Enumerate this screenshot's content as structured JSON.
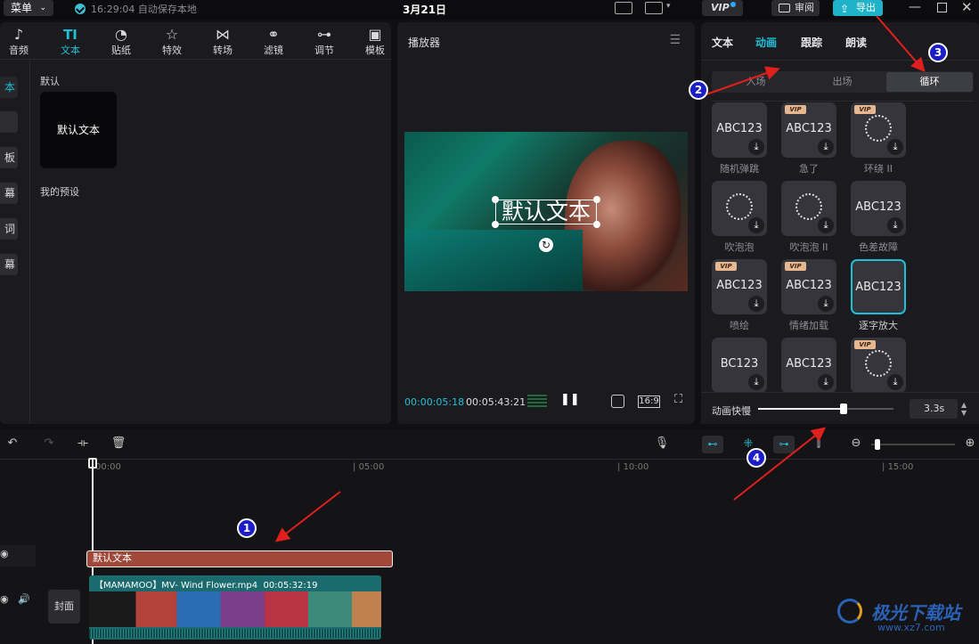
{
  "topbar": {
    "menu_label": "菜单",
    "autosave_text": "16:29:04 自动保存本地",
    "date_title": "3月21日",
    "vip_label": "VIP",
    "review_label": "审阅",
    "export_label": "导出"
  },
  "media_toolbar": [
    {
      "label": "音频",
      "icon": "music-clock-icon",
      "glyph": "♪"
    },
    {
      "label": "文本",
      "icon": "text-icon",
      "glyph": "TI"
    },
    {
      "label": "贴纸",
      "icon": "sticker-icon",
      "glyph": "◔"
    },
    {
      "label": "特效",
      "icon": "effects-star-icon",
      "glyph": "☆"
    },
    {
      "label": "转场",
      "icon": "transition-icon",
      "glyph": "⋈"
    },
    {
      "label": "滤镜",
      "icon": "filter-icon",
      "glyph": "⚭"
    },
    {
      "label": "调节",
      "icon": "adjust-sliders-icon",
      "glyph": "⊶"
    },
    {
      "label": "模板",
      "icon": "template-icon",
      "glyph": "▣"
    }
  ],
  "side_tabs": [
    "本",
    "",
    "板",
    "幕",
    "词",
    "幕"
  ],
  "text_panel": {
    "default_section": "默认",
    "default_card_text": "默认文本",
    "presets_section": "我的预设"
  },
  "player": {
    "title": "播放器",
    "overlay_text": "默认文本",
    "current_time": "00:00:05:18",
    "total_time": "00:05:43:21",
    "ratio_label": "16:9"
  },
  "inspector": {
    "tabs": [
      "文本",
      "动画",
      "跟踪",
      "朗读"
    ],
    "active_tab": "动画",
    "sub_tabs": [
      "入场",
      "出场",
      "循环"
    ],
    "active_sub_tab": "循环",
    "animations": [
      {
        "preview": "ABC123",
        "label": "随机弹跳",
        "vip": false
      },
      {
        "preview": "ABC123",
        "label": "急了",
        "vip": true
      },
      {
        "preview": "",
        "label": "环绕 II",
        "vip": true
      },
      {
        "preview": "",
        "label": "吹泡泡",
        "vip": false
      },
      {
        "preview": "",
        "label": "吹泡泡 II",
        "vip": false
      },
      {
        "preview": "ABC123",
        "label": "色差故障",
        "vip": false
      },
      {
        "preview": "ABC123",
        "label": "喷绘",
        "vip": true
      },
      {
        "preview": "ABC123",
        "label": "情绪加载",
        "vip": true
      },
      {
        "preview": "ABC123",
        "label": "逐字放大",
        "vip": false,
        "selected": true
      },
      {
        "preview": "BC123",
        "label": "",
        "vip": false
      },
      {
        "preview": "ABC123",
        "label": "",
        "vip": false
      },
      {
        "preview": "",
        "label": "",
        "vip": true
      }
    ],
    "vip_tag": "VIP",
    "speed_label": "动画快慢",
    "speed_value": "3.3s",
    "speed_level": 0.63
  },
  "timeline": {
    "ruler": [
      "00:00",
      "05:00",
      "10:00",
      "15:00"
    ],
    "text_clip_label": "默认文本",
    "video_clip_label": "【MAMAMOO】MV- Wind Flower.mp4",
    "video_clip_duration": "00:05:32:19",
    "cover_label": "封面"
  },
  "annotations": [
    "1",
    "2",
    "3",
    "4"
  ],
  "watermark": {
    "text": "极光下载站",
    "url": "www.xz7.com"
  },
  "colors": {
    "accent": "#1fc0d6",
    "text_clip": "#a0493b",
    "video_clip": "#1b6b6e",
    "badge": "#1c1cc8",
    "arrow": "#e0201d"
  }
}
